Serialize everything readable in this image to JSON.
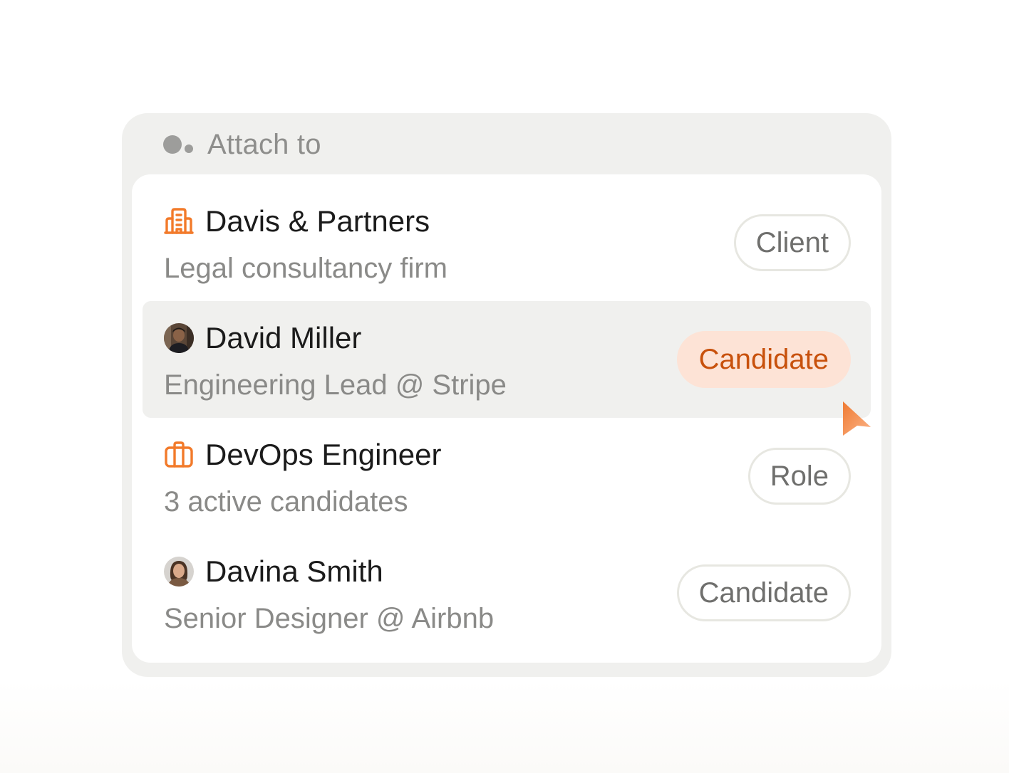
{
  "header": {
    "icon": "dots-icon",
    "title": "Attach to"
  },
  "items": [
    {
      "icon": "building-icon",
      "name": "Davis & Partners",
      "subtitle": "Legal consultancy firm",
      "badge": "Client",
      "highlighted": false
    },
    {
      "icon": "avatar-david-miller",
      "name": "David Miller",
      "subtitle": "Engineering Lead @ Stripe",
      "badge": "Candidate",
      "highlighted": true
    },
    {
      "icon": "briefcase-icon",
      "name": "DevOps Engineer",
      "subtitle": "3 active candidates",
      "badge": "Role",
      "highlighted": false
    },
    {
      "icon": "avatar-davina-smith",
      "name": "Davina Smith",
      "subtitle": "Senior Designer @ Airbnb",
      "badge": "Candidate",
      "highlighted": false
    }
  ],
  "colors": {
    "accent": "#f27a2a",
    "highlight_badge_bg": "#fde3d6",
    "highlight_badge_text": "#c8510c",
    "row_highlight_bg": "#f0f0ee"
  }
}
